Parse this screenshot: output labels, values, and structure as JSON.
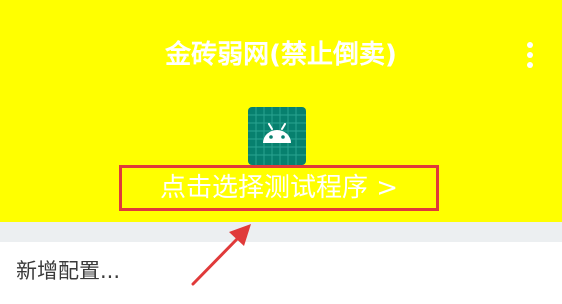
{
  "app_bar": {
    "title": "金砖弱网(禁止倒卖)",
    "menu_icon": "more-vert-icon"
  },
  "program_selector": {
    "icon": "android-app-icon",
    "label": "点击选择测试程序 >"
  },
  "config": {
    "add_label": "新增配置..."
  },
  "colors": {
    "header_background": "#ffff00",
    "text_on_header": "#ffffff",
    "highlight_border": "#e03a3a",
    "annotation_arrow": "#e03a3a",
    "icon_background": "#07806e",
    "divider_band": "#eceff1"
  }
}
